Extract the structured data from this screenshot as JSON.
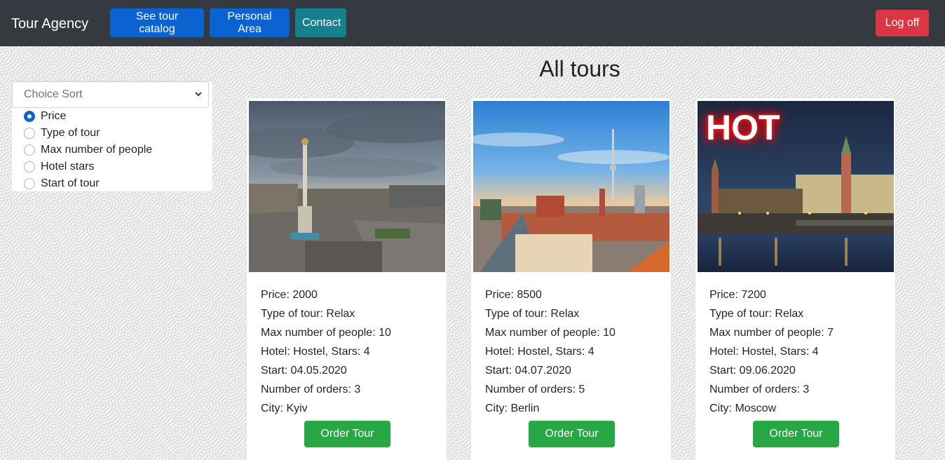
{
  "navbar": {
    "brand": "Tour Agency",
    "links": [
      "See tour catalog",
      "Personal Area",
      "Contact"
    ],
    "logoff": "Log off"
  },
  "sort": {
    "placeholder": "Choice Sort",
    "options": [
      "Price",
      "Type of tour",
      "Max number of people",
      "Hotel stars",
      "Start of tour"
    ],
    "selected": "Price"
  },
  "page_title": "All tours",
  "tours": [
    {
      "hot": false,
      "price": "Price: 2000",
      "type": "Type of tour: Relax",
      "max_people": "Max number of people: 10",
      "hotel": "Hotel: Hostel, Stars: 4",
      "start": "Start: 04.05.2020",
      "orders": "Number of orders: 3",
      "city": "City: Kyiv",
      "button": "Order Tour"
    },
    {
      "hot": false,
      "price": "Price: 8500",
      "type": "Type of tour: Relax",
      "max_people": "Max number of people: 10",
      "hotel": "Hotel: Hostel, Stars: 4",
      "start": "Start: 04.07.2020",
      "orders": "Number of orders: 5",
      "city": "City: Berlin",
      "button": "Order Tour"
    },
    {
      "hot": true,
      "hot_label": "HOT",
      "price": "Price: 7200",
      "type": "Type of tour: Relax",
      "max_people": "Max number of people: 7",
      "hotel": "Hotel: Hostel, Stars: 4",
      "start": "Start: 09.06.2020",
      "orders": "Number of orders: 3",
      "city": "City: Moscow",
      "button": "Order Tour"
    }
  ],
  "colors": {
    "navbar": "#343a40",
    "primary": "#0a63d0",
    "info": "#17808e",
    "danger": "#dc3545",
    "success": "#28a745"
  }
}
